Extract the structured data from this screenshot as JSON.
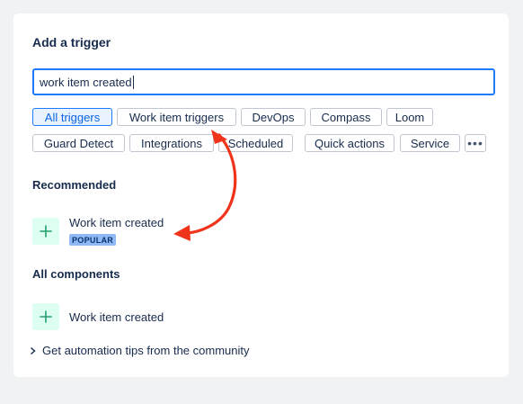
{
  "panel": {
    "title": "Add a trigger",
    "search": {
      "value": "work item created"
    },
    "filters": [
      {
        "label": "All triggers",
        "selected": true
      },
      {
        "label": "Work item triggers",
        "selected": false
      },
      {
        "label": "DevOps",
        "selected": false
      },
      {
        "label": "Compass",
        "selected": false
      },
      {
        "label": "Loom",
        "selected": false
      },
      {
        "label": "Guard Detect",
        "selected": false
      },
      {
        "label": "Integrations",
        "selected": false
      },
      {
        "label": "Scheduled",
        "selected": false
      },
      {
        "label": "Quick actions",
        "selected": false
      },
      {
        "label": "Service",
        "selected": false
      }
    ],
    "more_label": "•••",
    "recommended": {
      "heading": "Recommended",
      "items": [
        {
          "label": "Work item created",
          "badge": "POPULAR"
        }
      ]
    },
    "all_components": {
      "heading": "All components",
      "items": [
        {
          "label": "Work item created"
        }
      ]
    },
    "tips_link": "Get automation tips from the community"
  },
  "colors": {
    "accent": "#1d7afc",
    "annotation_arrow": "#f0341c",
    "plus_tile_bg": "#dcfff1",
    "plus_icon": "#22a06b",
    "badge_bg": "#8fb8f6"
  },
  "icons": [
    "plus-icon",
    "chevron-right-icon",
    "more-icon"
  ]
}
